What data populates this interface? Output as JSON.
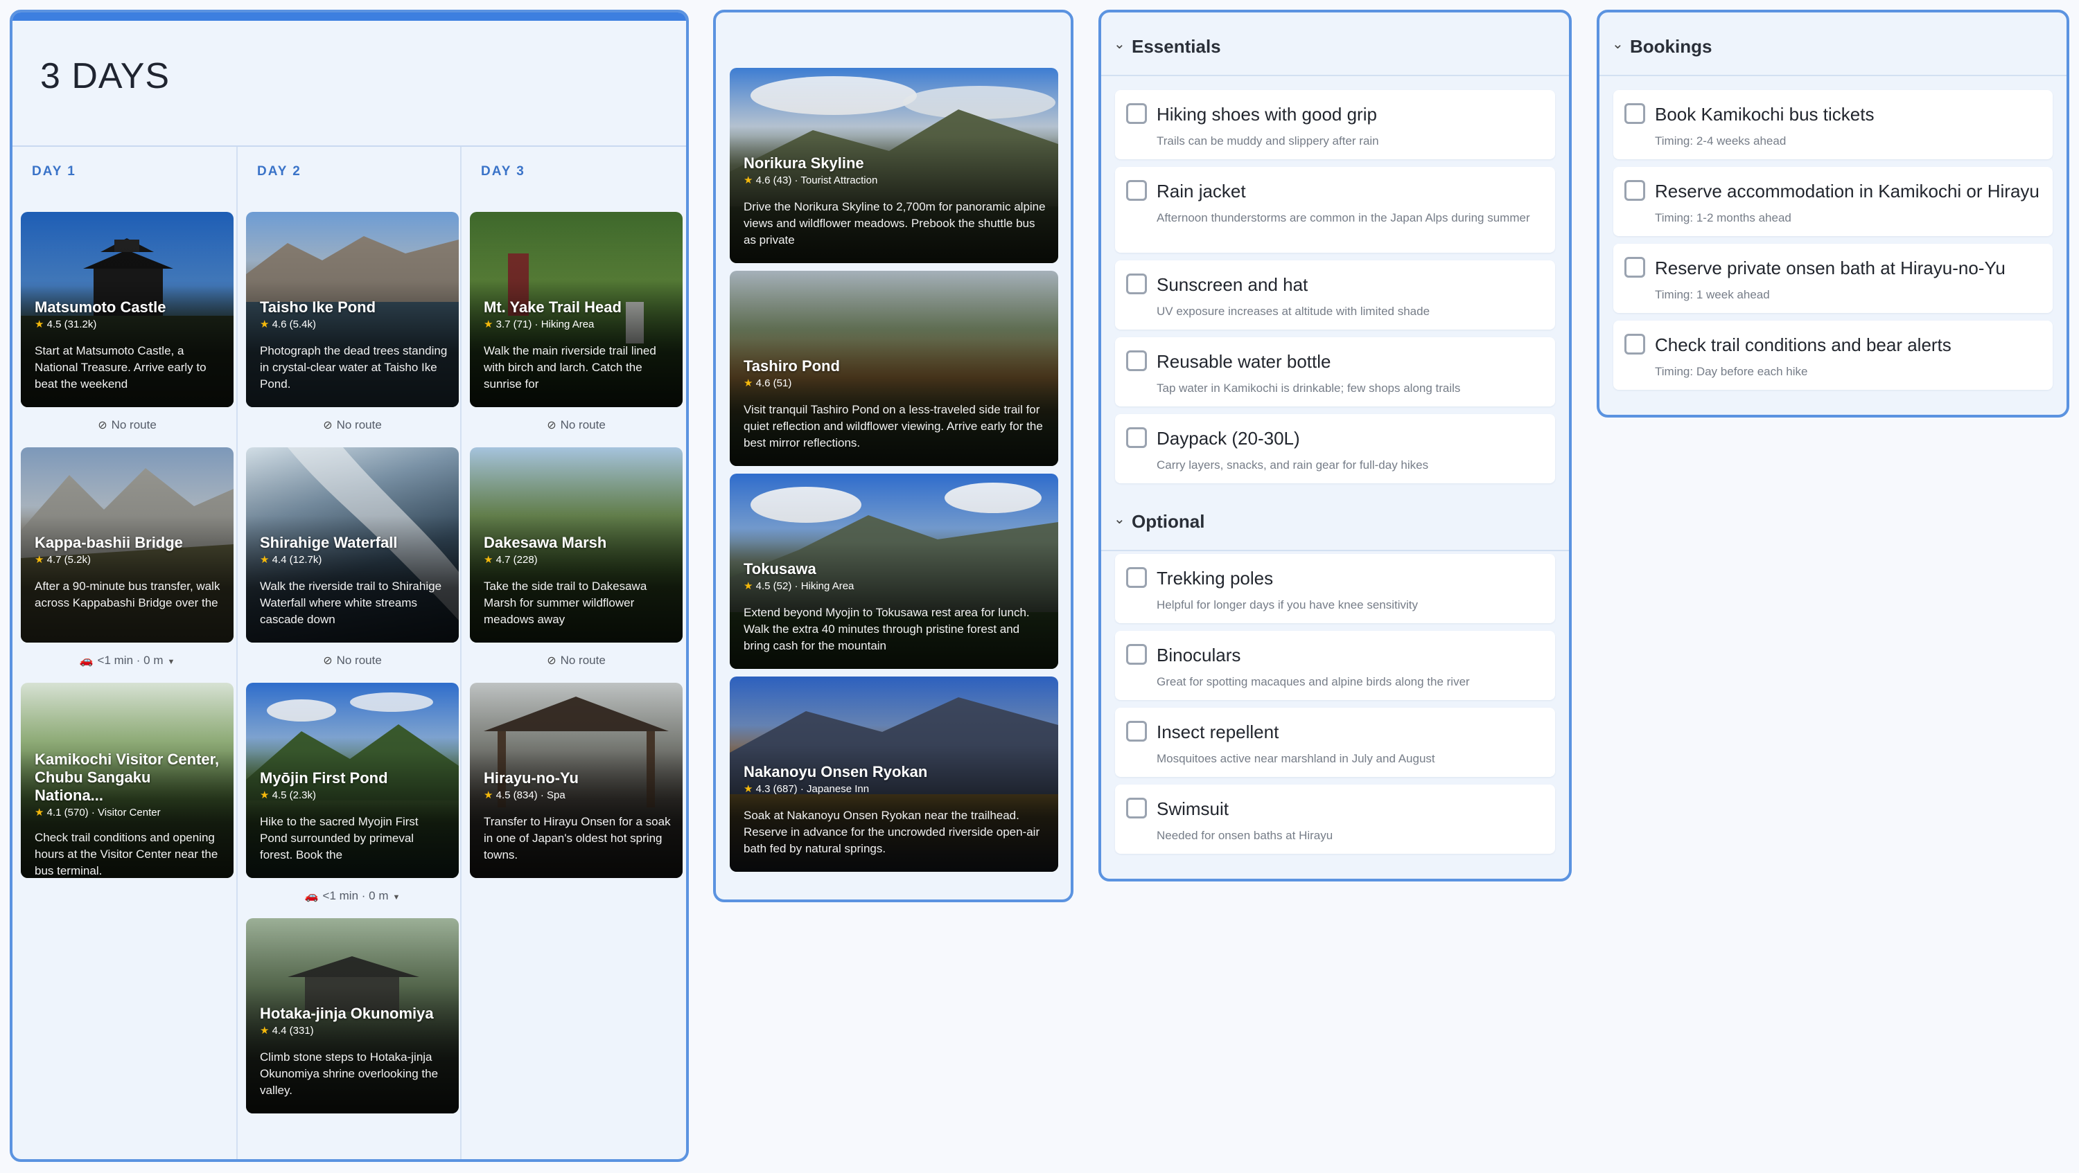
{
  "board": {
    "title": "3 DAYS"
  },
  "days": [
    {
      "label": "DAY 1",
      "places": [
        {
          "name": "Matsumoto Castle",
          "rating": "4.5",
          "reviews": "(31.2k)",
          "category": "",
          "desc": "Start at Matsumoto Castle, a National Treasure. Arrive early to beat the weekend"
        },
        {
          "name": "Kappa-bashii Bridge",
          "rating": "4.7",
          "reviews": "(5.2k)",
          "category": "",
          "desc": "After a 90-minute bus transfer, walk across Kappabashi Bridge over the"
        },
        {
          "name": "Kamikochi Visitor Center, Chubu Sangaku Nationa...",
          "rating": "4.1",
          "reviews": "(570)",
          "category": "Visitor Center",
          "desc": "Check trail conditions and opening hours at the Visitor Center near the bus terminal."
        }
      ],
      "connectors": [
        {
          "icon": "",
          "text": "No route"
        },
        {
          "icon": "car",
          "text": "<1 min · 0 m"
        }
      ]
    },
    {
      "label": "DAY 2",
      "places": [
        {
          "name": "Taisho Ike Pond",
          "rating": "4.6",
          "reviews": "(5.4k)",
          "category": "",
          "desc": "Photograph the dead trees standing in crystal-clear water at Taisho Ike Pond."
        },
        {
          "name": "Shirahige Waterfall",
          "rating": "4.4",
          "reviews": "(12.7k)",
          "category": "",
          "desc": "Walk the riverside trail to Shirahige Waterfall where white streams cascade down"
        },
        {
          "name": "Myōjin First Pond",
          "rating": "4.5",
          "reviews": "(2.3k)",
          "category": "",
          "desc": "Hike to the sacred Myojin First Pond surrounded by primeval forest. Book the"
        },
        {
          "name": "Hotaka-jinja Okunomiya",
          "rating": "4.4",
          "reviews": "(331)",
          "category": "",
          "desc": "Climb stone steps to Hotaka-jinja Okunomiya shrine overlooking the valley."
        }
      ],
      "connectors": [
        {
          "icon": "",
          "text": "No route"
        },
        {
          "icon": "",
          "text": "No route"
        },
        {
          "icon": "car",
          "text": "<1 min · 0 m"
        }
      ]
    },
    {
      "label": "DAY 3",
      "places": [
        {
          "name": "Mt. Yake Trail Head",
          "rating": "3.7",
          "reviews": "(71)",
          "category": "Hiking Area",
          "desc": "Walk the main riverside trail lined with birch and larch. Catch the sunrise for"
        },
        {
          "name": "Dakesawa Marsh",
          "rating": "4.7",
          "reviews": "(228)",
          "category": "",
          "desc": "Take the side trail to Dakesawa Marsh for summer wildflower meadows away"
        },
        {
          "name": "Hirayu-no-Yu",
          "rating": "4.5",
          "reviews": "(834)",
          "category": "Spa",
          "desc": "Transfer to Hirayu Onsen for a soak in one of Japan's oldest hot spring towns."
        }
      ],
      "connectors": [
        {
          "icon": "",
          "text": "No route"
        },
        {
          "icon": "",
          "text": "No route"
        }
      ]
    }
  ],
  "extras": [
    {
      "name": "Norikura Skyline",
      "rating": "4.6",
      "reviews": "(43)",
      "category": "Tourist Attraction",
      "desc": "Drive the Norikura Skyline to 2,700m for panoramic alpine views and wildflower meadows. Prebook the shuttle bus as private"
    },
    {
      "name": "Tashiro Pond",
      "rating": "4.6",
      "reviews": "(51)",
      "category": "",
      "desc": "Visit tranquil Tashiro Pond on a less-traveled side trail for quiet reflection and wildflower viewing. Arrive early for the best mirror reflections."
    },
    {
      "name": "Tokusawa",
      "rating": "4.5",
      "reviews": "(52)",
      "category": "Hiking Area",
      "desc": "Extend beyond Myojin to Tokusawa rest area for lunch. Walk the extra 40 minutes through pristine forest and bring cash for the mountain"
    },
    {
      "name": "Nakanoyu Onsen Ryokan",
      "rating": "4.3",
      "reviews": "(687)",
      "category": "Japanese Inn",
      "desc": "Soak at Nakanoyu Onsen Ryokan near the trailhead. Reserve in advance for the uncrowded riverside open-air bath fed by natural springs."
    }
  ],
  "essentials": {
    "label": "Essentials",
    "items": [
      {
        "title": "Hiking shoes with good grip",
        "sub": "Trails can be muddy and slippery after rain"
      },
      {
        "title": "Rain jacket",
        "sub": "Afternoon thunderstorms are common in the Japan Alps during summer"
      },
      {
        "title": "Sunscreen and hat",
        "sub": "UV exposure increases at altitude with limited shade"
      },
      {
        "title": "Reusable water bottle",
        "sub": "Tap water in Kamikochi is drinkable; few shops along trails"
      },
      {
        "title": "Daypack (20-30L)",
        "sub": "Carry layers, snacks, and rain gear for full-day hikes"
      }
    ]
  },
  "optional": {
    "label": "Optional",
    "items": [
      {
        "title": "Trekking poles",
        "sub": "Helpful for longer days if you have knee sensitivity"
      },
      {
        "title": "Binoculars",
        "sub": "Great for spotting macaques and alpine birds along the river"
      },
      {
        "title": "Insect repellent",
        "sub": "Mosquitoes active near marshland in July and August"
      },
      {
        "title": "Swimsuit",
        "sub": "Needed for onsen baths at Hirayu"
      }
    ]
  },
  "bookings": {
    "label": "Bookings",
    "items": [
      {
        "title": "Book Kamikochi bus tickets",
        "sub": "Timing: 2-4 weeks ahead"
      },
      {
        "title": "Reserve accommodation in Kamikochi or Hirayu",
        "sub": "Timing: 1-2 months ahead"
      },
      {
        "title": "Reserve private onsen bath at Hirayu-no-Yu",
        "sub": "Timing: 1 week ahead"
      },
      {
        "title": "Check trail conditions and bear alerts",
        "sub": "Timing: Day before each hike"
      }
    ]
  },
  "colors": {
    "accent": "#3d7fe0",
    "panel_border": "#5b93e0",
    "panel_bg": "#eef4fc",
    "star": "#f5b90c"
  }
}
